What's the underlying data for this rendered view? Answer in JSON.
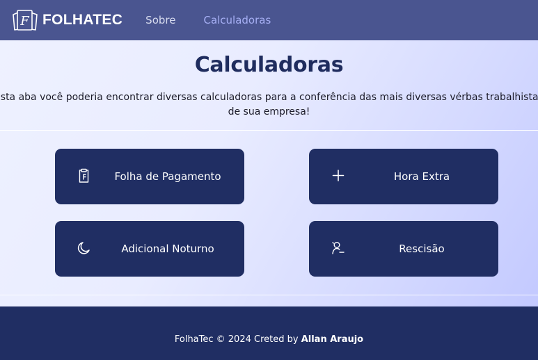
{
  "brand": {
    "name": "FOLHATEC",
    "logo_letter": "F",
    "logo_icon": "folha-logo-icon"
  },
  "nav": {
    "items": [
      {
        "label": "Sobre",
        "active": false
      },
      {
        "label": "Calculadoras",
        "active": true
      }
    ]
  },
  "main": {
    "title": "Calculadoras",
    "intro_line1": "esta aba você poderia encontrar diversas calculadoras para a conferência das mais diversas vérbas trabalhistas",
    "intro_line2": "de sua empresa!",
    "cards": [
      {
        "label": "Folha de Pagamento",
        "icon": "clipboard-icon"
      },
      {
        "label": "Hora Extra",
        "icon": "plus-icon"
      },
      {
        "label": "Adicional Noturno",
        "icon": "moon-icon"
      },
      {
        "label": "Rescisão",
        "icon": "user-minus-icon"
      }
    ]
  },
  "footer": {
    "text": "FolhaTec © 2024 Creted by ",
    "author": "Allan Araujo"
  },
  "colors": {
    "navbar": "#4a5590",
    "card": "#202e63",
    "footer": "#202e63",
    "title": "#1f2c5e",
    "active_link": "#a7b0f5"
  }
}
